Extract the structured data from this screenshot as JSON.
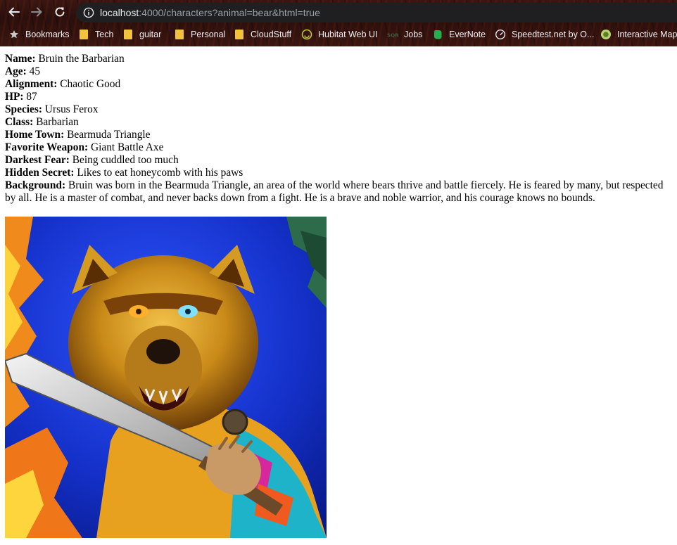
{
  "browser": {
    "url_host": "localhost",
    "url_rest": ":4000/characters?animal=bear&html=true"
  },
  "bookmarks": [
    {
      "label": "Bookmarks",
      "icon": "star-icon"
    },
    {
      "label": "Tech",
      "icon": "folder-icon"
    },
    {
      "label": "guitar",
      "icon": "folder-icon"
    },
    {
      "label": "Personal",
      "icon": "folder-icon"
    },
    {
      "label": "CloudStuff",
      "icon": "folder-icon"
    },
    {
      "label": "Hubitat Web UI",
      "icon": "hubitat-icon"
    },
    {
      "label": "Jobs",
      "icon": "sqr-icon"
    },
    {
      "label": "EverNote",
      "icon": "evernote-icon"
    },
    {
      "label": "Speedtest.net by O...",
      "icon": "speedtest-icon"
    },
    {
      "label": "Interactive Map",
      "icon": "map-icon"
    }
  ],
  "character": {
    "fields": [
      {
        "label": "Name:",
        "value": "Bruin the Barbarian"
      },
      {
        "label": "Age:",
        "value": "45"
      },
      {
        "label": "Alignment:",
        "value": "Chaotic Good"
      },
      {
        "label": "HP:",
        "value": "87"
      },
      {
        "label": "Species:",
        "value": "Ursus Ferox"
      },
      {
        "label": "Class:",
        "value": "Barbarian"
      },
      {
        "label": "Home Town:",
        "value": "Bearmuda Triangle"
      },
      {
        "label": "Favorite Weapon:",
        "value": "Giant Battle Axe"
      },
      {
        "label": "Darkest Fear:",
        "value": "Being cuddled too much"
      },
      {
        "label": "Hidden Secret:",
        "value": "Likes to eat honeycomb with his paws"
      },
      {
        "label": "Background:",
        "value": "Bruin was born in the Bearmuda Triangle, an area of the world where bears thrive and battle fiercely. He is feared by many, but respected by all. He is a master of combat, and never backs down from a fight. He is a brave and noble warrior, and his courage knows no bounds."
      }
    ]
  },
  "colors": {
    "folder": "#f3c23c",
    "omnibox": "#1f1f22",
    "chrome": "#2b0f0c"
  }
}
